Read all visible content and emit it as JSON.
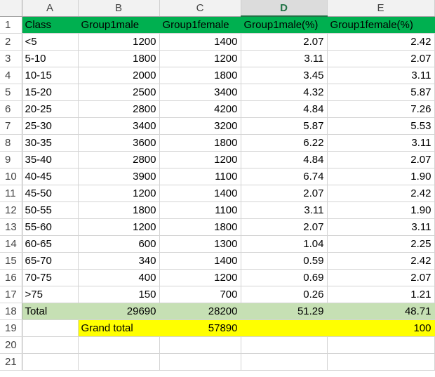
{
  "columns": [
    "A",
    "B",
    "C",
    "D",
    "E"
  ],
  "selected_column": "D",
  "colors": {
    "header_fill": "#00b050",
    "total_fill": "#c6e0b4",
    "grand_total_fill": "#ffff00",
    "selected_column_text": "#217346"
  },
  "rows": [
    {
      "num": "1",
      "cells": [
        "Class",
        "Group1male",
        "Group1female",
        "Group1male(%)",
        "Group1female(%)"
      ],
      "style": "header"
    },
    {
      "num": "2",
      "cells": [
        "<5",
        "1200",
        "1400",
        "2.07",
        "2.42"
      ]
    },
    {
      "num": "3",
      "cells": [
        "5-10",
        "1800",
        "1200",
        "3.11",
        "2.07"
      ]
    },
    {
      "num": "4",
      "cells": [
        "10-15",
        "2000",
        "1800",
        "3.45",
        "3.11"
      ]
    },
    {
      "num": "5",
      "cells": [
        "15-20",
        "2500",
        "3400",
        "4.32",
        "5.87"
      ]
    },
    {
      "num": "6",
      "cells": [
        "20-25",
        "2800",
        "4200",
        "4.84",
        "7.26"
      ]
    },
    {
      "num": "7",
      "cells": [
        "25-30",
        "3400",
        "3200",
        "5.87",
        "5.53"
      ]
    },
    {
      "num": "8",
      "cells": [
        "30-35",
        "3600",
        "1800",
        "6.22",
        "3.11"
      ]
    },
    {
      "num": "9",
      "cells": [
        "35-40",
        "2800",
        "1200",
        "4.84",
        "2.07"
      ]
    },
    {
      "num": "10",
      "cells": [
        "40-45",
        "3900",
        "1100",
        "6.74",
        "1.90"
      ]
    },
    {
      "num": "11",
      "cells": [
        "45-50",
        "1200",
        "1400",
        "2.07",
        "2.42"
      ]
    },
    {
      "num": "12",
      "cells": [
        "50-55",
        "1800",
        "1100",
        "3.11",
        "1.90"
      ]
    },
    {
      "num": "13",
      "cells": [
        "55-60",
        "1200",
        "1800",
        "2.07",
        "3.11"
      ]
    },
    {
      "num": "14",
      "cells": [
        "60-65",
        "600",
        "1300",
        "1.04",
        "2.25"
      ]
    },
    {
      "num": "15",
      "cells": [
        "65-70",
        "340",
        "1400",
        "0.59",
        "2.42"
      ]
    },
    {
      "num": "16",
      "cells": [
        "70-75",
        "400",
        "1200",
        "0.69",
        "2.07"
      ]
    },
    {
      "num": "17",
      "cells": [
        ">75",
        "150",
        "700",
        "0.26",
        "1.21"
      ]
    },
    {
      "num": "18",
      "cells": [
        "Total",
        "29690",
        "28200",
        "51.29",
        "48.71"
      ],
      "style": "total"
    },
    {
      "num": "19",
      "cells": [
        "",
        "Grand total",
        "57890",
        "",
        "100"
      ],
      "style": "grand"
    },
    {
      "num": "20",
      "cells": [
        "",
        "",
        "",
        "",
        ""
      ]
    },
    {
      "num": "21",
      "cells": [
        "",
        "",
        "",
        "",
        ""
      ]
    }
  ]
}
